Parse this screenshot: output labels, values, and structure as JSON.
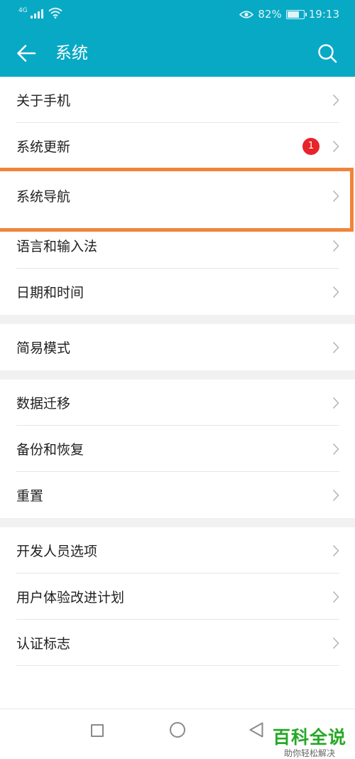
{
  "status_bar": {
    "network": "4G",
    "battery_percent_text": "82%",
    "battery_level": 0.82,
    "time": "19:13"
  },
  "app_bar": {
    "title": "系统",
    "back_icon": "arrow-left-icon",
    "search_icon": "search-icon"
  },
  "groups": [
    {
      "items": [
        {
          "label": "关于手机"
        },
        {
          "label": "系统更新",
          "badge": "1"
        },
        {
          "label": "系统导航",
          "highlighted": true
        },
        {
          "label": "语言和输入法"
        },
        {
          "label": "日期和时间"
        }
      ]
    },
    {
      "items": [
        {
          "label": "简易模式"
        }
      ]
    },
    {
      "items": [
        {
          "label": "数据迁移"
        },
        {
          "label": "备份和恢复"
        },
        {
          "label": "重置"
        }
      ]
    },
    {
      "items": [
        {
          "label": "开发人员选项"
        },
        {
          "label": "用户体验改进计划"
        },
        {
          "label": "认证标志"
        }
      ]
    }
  ],
  "nav_bar": {
    "recent_icon": "square-icon",
    "home_icon": "circle-icon",
    "back_icon": "triangle-back-icon"
  },
  "watermark": {
    "title": "百科全说",
    "subtitle": "助你轻松解决"
  },
  "colors": {
    "header": "#08a9c5",
    "highlight": "#f0843a",
    "badge": "#e8242a",
    "watermark": "#26a826"
  }
}
